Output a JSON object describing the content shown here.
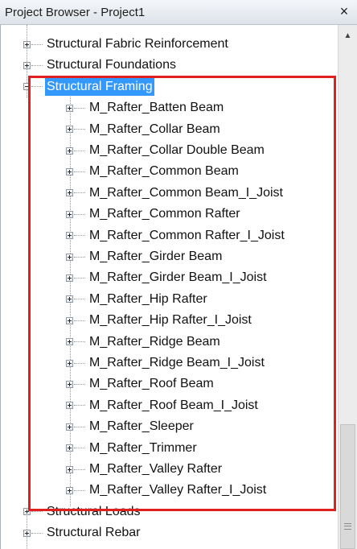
{
  "window": {
    "title": "Project Browser - Project1",
    "close_symbol": "×"
  },
  "tree": {
    "top_items": [
      {
        "label": "Structural Fabric Reinforcement",
        "expanded": false
      },
      {
        "label": "Structural Foundations",
        "expanded": false
      },
      {
        "label": "Structural Framing",
        "expanded": true,
        "selected": true
      }
    ],
    "framing_children": [
      "M_Rafter_Batten Beam",
      "M_Rafter_Collar Beam",
      "M_Rafter_Collar Double Beam",
      "M_Rafter_Common Beam",
      "M_Rafter_Common Beam_I_Joist",
      "M_Rafter_Common Rafter",
      "M_Rafter_Common Rafter_I_Joist",
      "M_Rafter_Girder Beam",
      "M_Rafter_Girder Beam_I_Joist",
      "M_Rafter_Hip Rafter",
      "M_Rafter_Hip Rafter_I_Joist",
      "M_Rafter_Ridge Beam",
      "M_Rafter_Ridge Beam_I_Joist",
      "M_Rafter_Roof Beam",
      "M_Rafter_Roof Beam_I_Joist",
      "M_Rafter_Sleeper",
      "M_Rafter_Trimmer",
      "M_Rafter_Valley Rafter",
      "M_Rafter_Valley Rafter_I_Joist"
    ],
    "bottom_items": [
      {
        "label": "Structural Loads",
        "expanded": false
      },
      {
        "label": "Structural Rebar",
        "expanded": false
      }
    ]
  },
  "colors": {
    "selection": "#3399ff",
    "highlight_box": "#e01f1f"
  },
  "icons": {
    "expand": "plus-box-icon",
    "collapse": "minus-box-icon",
    "scroll_up": "arrow-up-icon"
  }
}
